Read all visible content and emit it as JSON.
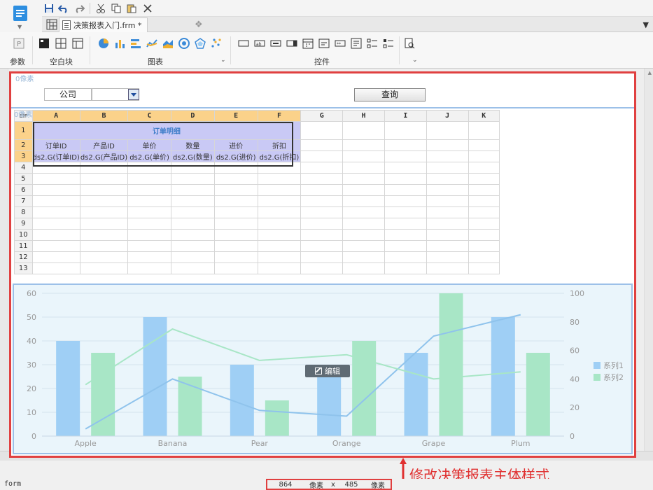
{
  "toolbar": {
    "icons": [
      "save-icon",
      "undo-icon",
      "redo-icon",
      "cut-icon",
      "copy-icon",
      "paste-icon",
      "delete-icon"
    ]
  },
  "tab": {
    "label": "决策报表入门.frm *",
    "close": "✕"
  },
  "ribbon": {
    "groups": {
      "param": "参数",
      "blank": "空白块",
      "chart": "图表",
      "control": "控件"
    }
  },
  "form": {
    "param_pane_px": "0像素",
    "report_px": "0像素",
    "param_label": "公司",
    "query_button": "查询"
  },
  "report": {
    "corner": "ElF",
    "columns": [
      "A",
      "B",
      "C",
      "D",
      "E",
      "F",
      "G",
      "H",
      "I",
      "J",
      "K"
    ],
    "rows": [
      "1",
      "2",
      "3",
      "4",
      "5",
      "6",
      "7",
      "8",
      "9",
      "10",
      "11",
      "12",
      "13"
    ],
    "title": "订单明细",
    "headers": [
      "订单ID",
      "产品ID",
      "单价",
      "数量",
      "进价",
      "折扣"
    ],
    "ds_cells": [
      "ds2.G(订单ID)",
      "ds2.G(产品ID)",
      "ds2.G(单价)",
      "ds2.G(数量)",
      "ds2.G(进价)",
      "ds2.G(折扣)"
    ]
  },
  "chart_data": {
    "type": "bar",
    "categories": [
      "Apple",
      "Banana",
      "Pear",
      "Orange",
      "Grape",
      "Plum"
    ],
    "series": [
      {
        "name": "系列1",
        "values": [
          40,
          50,
          30,
          25,
          35,
          50
        ],
        "color": "#9fcff5"
      },
      {
        "name": "系列2",
        "values": [
          35,
          25,
          15,
          40,
          60,
          35
        ],
        "color": "#a8e6c6"
      }
    ],
    "lines": [
      {
        "series": "系列1",
        "values": [
          5,
          40,
          18,
          14,
          70,
          85
        ],
        "color": "#8fc3ec"
      },
      {
        "series": "系列2",
        "values": [
          36,
          75,
          53,
          57,
          40,
          45
        ],
        "color": "#a8e6c6"
      }
    ],
    "ylim_left": [
      0,
      60
    ],
    "yticks_left": [
      "0",
      "10",
      "20",
      "30",
      "40",
      "50",
      "60"
    ],
    "ylim_right": [
      0,
      100
    ],
    "yticks_right": [
      "0",
      "20",
      "40",
      "60",
      "80",
      "100"
    ],
    "legend_position": "right",
    "grid": true,
    "edit_button": "编辑"
  },
  "annotation": {
    "text": "修改决策报表主体样式",
    "color": "#e03030"
  },
  "status": {
    "left": "form",
    "width_value": "864",
    "width_unit": "像素",
    "separator": "x",
    "height_value": "485",
    "height_unit": "像素"
  }
}
